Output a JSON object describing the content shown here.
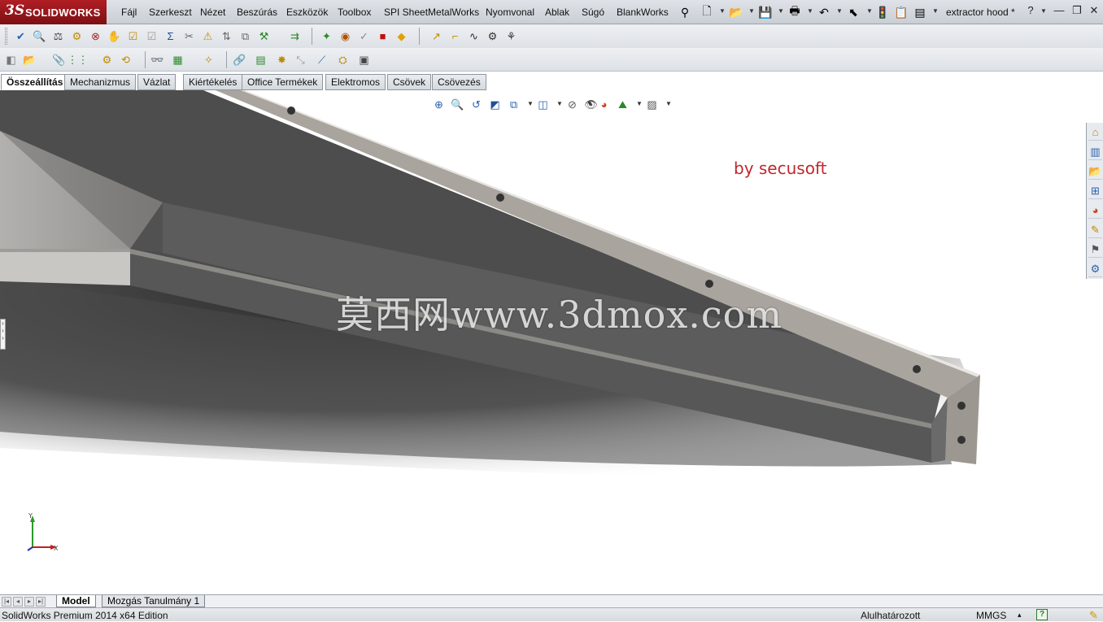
{
  "app": {
    "logo_ds": "3S",
    "logo_name": "SOLIDWORKS",
    "document_title": "extractor hood *"
  },
  "menu": {
    "items": [
      "Fájl",
      "Szerkeszt",
      "Nézet",
      "Beszúrás",
      "Eszközök",
      "Toolbox",
      "SPI SheetMetalWorks",
      "Nyomvonal",
      "Ablak",
      "Súgó",
      "BlankWorks"
    ]
  },
  "quick_access": [
    {
      "icon": "pin-icon",
      "glyph": "⚲"
    },
    {
      "icon": "new-document-icon",
      "glyph": "🗋"
    },
    {
      "icon": "open-folder-icon",
      "glyph": "📂"
    },
    {
      "icon": "save-icon",
      "glyph": "💾"
    },
    {
      "icon": "print-icon",
      "glyph": "🖶"
    },
    {
      "icon": "undo-icon",
      "glyph": "↶"
    },
    {
      "icon": "select-cursor-icon",
      "glyph": "⬉"
    },
    {
      "icon": "rebuild-traffic-light-icon",
      "glyph": "🚦"
    },
    {
      "icon": "file-properties-icon",
      "glyph": "📋"
    },
    {
      "icon": "options-icon",
      "glyph": "▤"
    }
  ],
  "window_controls": {
    "help_glyph": "?",
    "minimize_glyph": "—",
    "restore_glyph": "❐",
    "close_glyph": "✕"
  },
  "toolbar1": {
    "icons": [
      {
        "name": "spell-check-icon",
        "glyph": "✔",
        "color": "#2a5fb0"
      },
      {
        "name": "find-replace-icon",
        "glyph": "🔍",
        "color": "#444444"
      },
      {
        "name": "measure-icon",
        "glyph": "⚖",
        "color": "#444444"
      },
      {
        "name": "mass-properties-icon",
        "glyph": "⚙",
        "color": "#c08a00"
      },
      {
        "name": "interference-detection-icon",
        "glyph": "⊗",
        "color": "#b02020"
      },
      {
        "name": "clearance-verification-icon",
        "glyph": "✋",
        "color": "#666666"
      },
      {
        "name": "check-icon",
        "glyph": "☑",
        "color": "#c08a00"
      },
      {
        "name": "check-disabled-icon",
        "glyph": "☑",
        "color": "#9a9a9a"
      },
      {
        "name": "equations-sigma-icon",
        "glyph": "Σ",
        "color": "#1f4d99"
      },
      {
        "name": "tools-icon",
        "glyph": "✂",
        "color": "#666666"
      },
      {
        "name": "warning-icon",
        "glyph": "⚠",
        "color": "#d08a00"
      },
      {
        "name": "split-icon",
        "glyph": "⇅",
        "color": "#666666"
      },
      {
        "name": "compare-icon",
        "glyph": "⧉",
        "color": "#666666"
      },
      {
        "name": "filter-icon",
        "glyph": "⚒",
        "color": "#2a8a2a"
      },
      {
        "name": "export-icon",
        "glyph": "⇉",
        "color": "#2a8a2a"
      },
      {
        "name": "weld-icon",
        "glyph": "✦",
        "color": "#2a8a2a"
      },
      {
        "name": "hole-series-icon",
        "glyph": "◉",
        "color": "#b05000"
      },
      {
        "name": "validate-icon",
        "glyph": "✓",
        "color": "#888888"
      },
      {
        "name": "color-square-icon",
        "glyph": "■",
        "color": "#c01010"
      },
      {
        "name": "appearance-icon",
        "glyph": "◆",
        "color": "#e0a000"
      },
      {
        "name": "route-icon",
        "glyph": "↗",
        "color": "#c08a00"
      },
      {
        "name": "pipe-icon",
        "glyph": "⌐",
        "color": "#c08a00"
      },
      {
        "name": "spline-icon",
        "glyph": "∿",
        "color": "#333333"
      },
      {
        "name": "route-properties-icon",
        "glyph": "⚙",
        "color": "#333333"
      },
      {
        "name": "wire-icon",
        "glyph": "⚘",
        "color": "#333333"
      }
    ]
  },
  "toolbar2": {
    "icons": [
      {
        "name": "component-icon",
        "glyph": "◧",
        "color": "#777777"
      },
      {
        "name": "insert-component-icon",
        "glyph": "📂",
        "color": "#c08a00"
      },
      {
        "name": "mate-icon",
        "glyph": "📎",
        "color": "#444444"
      },
      {
        "name": "linear-pattern-icon",
        "glyph": "⋮⋮",
        "color": "#2a8a2a"
      },
      {
        "name": "smart-fasteners-icon",
        "glyph": "⚙",
        "color": "#c08a00"
      },
      {
        "name": "move-component-icon",
        "glyph": "⟲",
        "color": "#c08a00"
      },
      {
        "name": "show-hidden-icon",
        "glyph": "👓",
        "color": "#444444"
      },
      {
        "name": "assembly-features-icon",
        "glyph": "▦",
        "color": "#2a8a2a"
      },
      {
        "name": "reference-geometry-icon",
        "glyph": "✧",
        "color": "#c08a00"
      },
      {
        "name": "new-motion-study-icon",
        "glyph": "🔗",
        "color": "#444444"
      },
      {
        "name": "bill-of-materials-icon",
        "glyph": "▤",
        "color": "#2a8a2a"
      },
      {
        "name": "exploded-view-icon",
        "glyph": "✸",
        "color": "#c08a00"
      },
      {
        "name": "explode-line-sketch-icon",
        "glyph": "⤡",
        "color": "#999999"
      },
      {
        "name": "instant3d-icon",
        "glyph": "⟋",
        "color": "#2a5fb0"
      },
      {
        "name": "large-assembly-icon",
        "glyph": "⛭",
        "color": "#c08a00"
      },
      {
        "name": "snapshot-icon",
        "glyph": "▣",
        "color": "#444444"
      }
    ]
  },
  "command_tabs": [
    "Összeállítás",
    "Mechanizmus",
    "Vázlat",
    "Kiértékelés",
    "Office Termékek",
    "Elektromos",
    "Csövek",
    "Csövezés"
  ],
  "command_tabs_active": 0,
  "heads_up": [
    {
      "name": "zoom-to-fit-icon",
      "glyph": "⊕",
      "color": "#2a5fb0"
    },
    {
      "name": "zoom-to-area-icon",
      "glyph": "🔍",
      "color": "#2a5fb0"
    },
    {
      "name": "previous-view-icon",
      "glyph": "↺",
      "color": "#2a5fb0"
    },
    {
      "name": "section-view-icon",
      "glyph": "◩",
      "color": "#1f4d99"
    },
    {
      "name": "dynamic-annotation-icon",
      "glyph": "⧉",
      "color": "#2a5fb0"
    },
    {
      "name": "view-orientation-icon",
      "glyph": "◫",
      "color": "#2a5fb0"
    },
    {
      "name": "display-style-icon",
      "glyph": "⊘",
      "color": "#555555"
    },
    {
      "name": "hide-show-items-icon",
      "glyph": "👁",
      "color": "#555555"
    },
    {
      "name": "edit-appearance-icon",
      "glyph": "◕",
      "color": "#d04020"
    },
    {
      "name": "apply-scene-icon",
      "glyph": "⛰",
      "color": "#2a8a2a"
    },
    {
      "name": "view-settings-icon",
      "glyph": "▨",
      "color": "#555555"
    }
  ],
  "viewport": {
    "credit_text": "by secusoft",
    "watermark_text": "莫西网www.3dmox.com",
    "triad_x_label": "X",
    "triad_y_label": "Y"
  },
  "viewport_controls": [
    "tile-horizontal-icon",
    "tile-vertical-icon",
    "minimize-icon",
    "restore-icon",
    "close-icon"
  ],
  "task_pane": [
    {
      "name": "solidworks-resources-icon",
      "glyph": "⌂"
    },
    {
      "name": "design-library-icon",
      "glyph": "▥"
    },
    {
      "name": "file-explorer-icon",
      "glyph": "📂"
    },
    {
      "name": "view-palette-icon",
      "glyph": "⊞"
    },
    {
      "name": "appearances-icon",
      "glyph": "◕"
    },
    {
      "name": "custom-properties-icon",
      "glyph": "✎"
    },
    {
      "name": "solidworks-forum-icon",
      "glyph": "⚑"
    },
    {
      "name": "toolbox-icon",
      "glyph": "⚙"
    }
  ],
  "bottom_tabs": [
    "Model",
    "Mozgás Tanulmány 1"
  ],
  "bottom_tabs_active": 0,
  "status": {
    "edition": "SolidWorks Premium 2014 x64 Edition",
    "definition": "Alulhatározott",
    "units": "MMGS",
    "units_arrow": "▴",
    "help_glyph": "?",
    "edit_glyph": "✎"
  },
  "colors": {
    "brand_red": "#b01f24",
    "credit_red": "#c0282d",
    "model_light": "#a7a29b",
    "model_mid": "#6e6e6e",
    "model_dark": "#3b3b3b"
  }
}
